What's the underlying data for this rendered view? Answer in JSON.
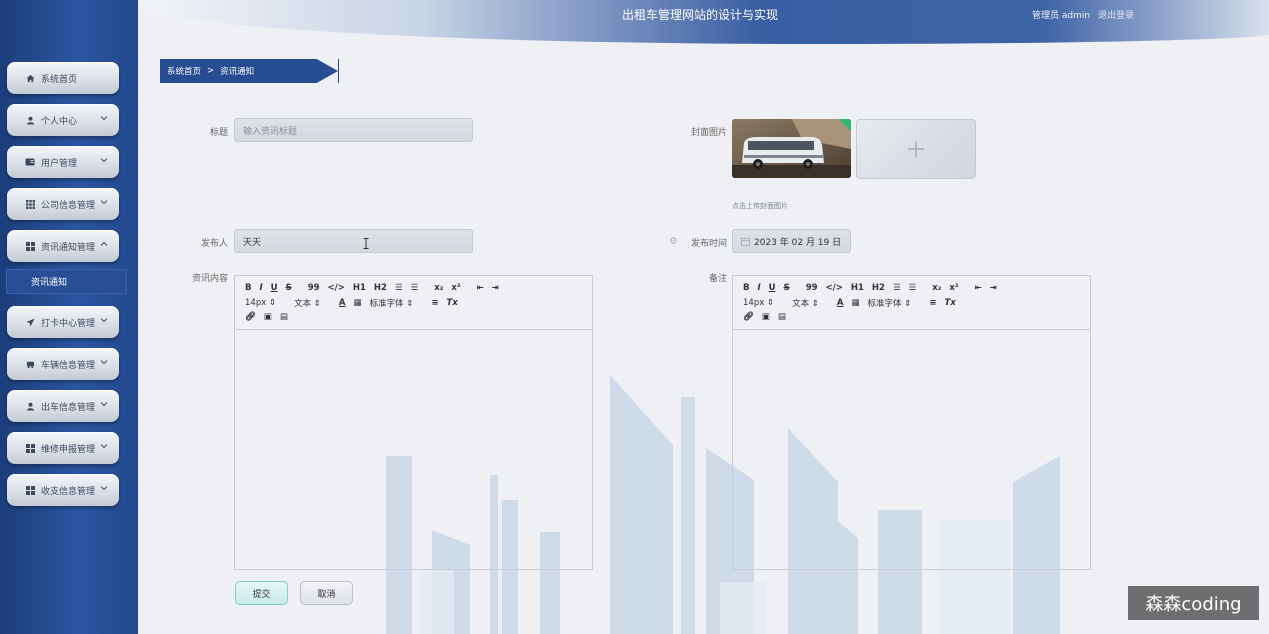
{
  "header": {
    "title": "出租车管理网站的设计与实现",
    "user_label": "管理员 admin",
    "logout_label": "退出登录"
  },
  "sidebar": {
    "items": [
      {
        "label": "系统首页",
        "icon": "home-icon"
      },
      {
        "label": "个人中心",
        "icon": "user-icon"
      },
      {
        "label": "用户管理",
        "icon": "id-card-icon"
      },
      {
        "label": "公司信息管理",
        "icon": "grid-icon"
      },
      {
        "label": "资讯通知管理",
        "icon": "apps-icon"
      },
      {
        "label": "打卡中心管理",
        "icon": "send-icon"
      },
      {
        "label": "车辆信息管理",
        "icon": "car-icon"
      },
      {
        "label": "出车信息管理",
        "icon": "person-icon"
      },
      {
        "label": "维修申报管理",
        "icon": "apps-icon"
      },
      {
        "label": "收支信息管理",
        "icon": "apps-icon"
      }
    ],
    "active_sub_item": "资讯通知"
  },
  "breadcrumb": {
    "home": "系统首页",
    "separator": ">",
    "current": "资讯通知"
  },
  "form": {
    "title_label": "标题",
    "title_placeholder": "输入资讯标题",
    "cover_label": "封面图片",
    "cover_upload_tip": "点击上传封面图片",
    "publisher_label": "发布人",
    "publisher_value": "天天",
    "publish_time_label": "发布时间",
    "publish_time_value": "2023 年 02 月 19 日",
    "content_label": "资讯内容",
    "remark_label": "备注",
    "submit_label": "提交",
    "cancel_label": "取消"
  },
  "editor_toolbar": {
    "font_size": "14px",
    "text_style": "文本",
    "font_family": "标准字体"
  },
  "watermark": "森森coding",
  "colors": {
    "sidebar": "#2b56a0",
    "breadcrumb": "#264c91",
    "submit_border": "#79cfca"
  }
}
